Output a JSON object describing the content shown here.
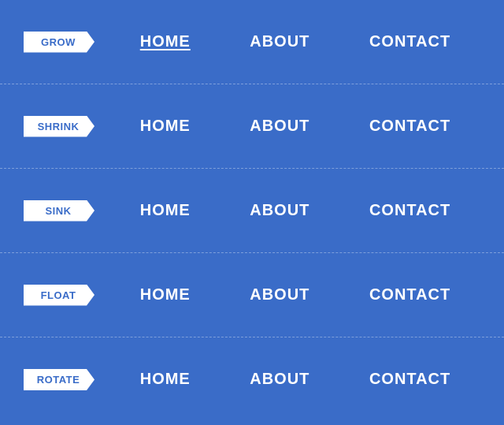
{
  "rows": [
    {
      "id": "grow",
      "badge": "GROW",
      "links": [
        "HOME",
        "ABOUT",
        "CONTACT"
      ],
      "activeLink": "HOME"
    },
    {
      "id": "shrink",
      "badge": "SHRINK",
      "links": [
        "HOME",
        "ABOUT",
        "CONTACT"
      ],
      "activeLink": null
    },
    {
      "id": "sink",
      "badge": "SINK",
      "links": [
        "HOME",
        "ABOUT",
        "CONTACT"
      ],
      "activeLink": null
    },
    {
      "id": "float",
      "badge": "FLOAT",
      "links": [
        "HOME",
        "ABOUT",
        "CONTACT"
      ],
      "activeLink": null
    },
    {
      "id": "rotate",
      "badge": "ROTATE",
      "links": [
        "HOME",
        "ABOUT",
        "CONTACT"
      ],
      "activeLink": null
    }
  ],
  "colors": {
    "background": "#3a6cc8",
    "badge_bg": "#ffffff",
    "badge_text": "#3a6cc8",
    "nav_text": "#ffffff"
  }
}
